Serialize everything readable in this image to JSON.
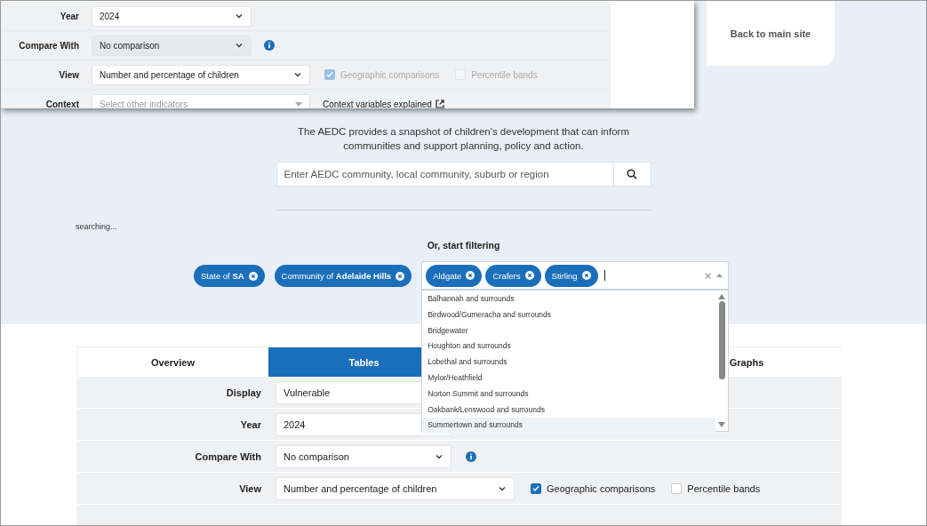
{
  "overlay_form": {
    "rows": [
      {
        "kind": "select",
        "label": "Year",
        "value": "2024",
        "disabled": false
      },
      {
        "kind": "select_info",
        "label": "Compare With",
        "value": "No comparison",
        "disabled": true
      },
      {
        "kind": "view",
        "label": "View",
        "value": "Number and percentage of children",
        "disabled": false,
        "checkboxes": [
          {
            "label": "Geographic comparisons",
            "checked": true,
            "disabled": true
          },
          {
            "label": "Percentile bands",
            "checked": false,
            "disabled": true
          }
        ]
      },
      {
        "kind": "context",
        "label": "Context",
        "placeholder": "Select other indicators",
        "link": "Context variables explained"
      }
    ]
  },
  "header": {
    "back_link": "Back to main site"
  },
  "hero": {
    "description": "The AEDC provides a snapshot of children's development that can inform communities and support planning, policy and action.",
    "search": {
      "placeholder": "Enter AEDC community, local community, suburb or region"
    },
    "status": "searching...",
    "filter_heading": "Or, start filtering",
    "filters": [
      {
        "label": "State of **SA**"
      },
      {
        "label": "Community of **Adelaide Hills**"
      }
    ],
    "multiselect": {
      "tags": [
        "Aldgate",
        "Crafers",
        "Stirling"
      ],
      "options": [
        {
          "label": "Balhannah and surrounds",
          "selected": false
        },
        {
          "label": "Birdwood/Gumeracha and surrounds",
          "selected": false
        },
        {
          "label": "Bridgewater",
          "selected": false
        },
        {
          "label": "Houghton and surrounds",
          "selected": false
        },
        {
          "label": "Lobethal and surrounds",
          "selected": false
        },
        {
          "label": "Mylor/Heathfield",
          "selected": false
        },
        {
          "label": "Norton Summit and surrounds",
          "selected": false
        },
        {
          "label": "Oakbank/Lenswood and surrounds",
          "selected": false
        },
        {
          "label": "Summertown and surrounds",
          "selected": true
        }
      ]
    }
  },
  "tabs": [
    {
      "label": "Overview",
      "selected": false
    },
    {
      "label": "Tables",
      "selected": true
    },
    {
      "label": "Graphs",
      "selected": false
    }
  ],
  "form": {
    "rows": [
      {
        "kind": "select",
        "label": "Display",
        "value": "Vulnerable",
        "disabled": false
      },
      {
        "kind": "select",
        "label": "Year",
        "value": "2024",
        "disabled": false
      },
      {
        "kind": "select_info",
        "label": "Compare With",
        "value": "No comparison",
        "disabled": false
      },
      {
        "kind": "view",
        "label": "View",
        "value": "Number and percentage of children",
        "disabled": false,
        "checkboxes": [
          {
            "label": "Geographic comparisons",
            "checked": true,
            "disabled": false
          },
          {
            "label": "Percentile bands",
            "checked": false,
            "disabled": false
          }
        ]
      }
    ]
  }
}
